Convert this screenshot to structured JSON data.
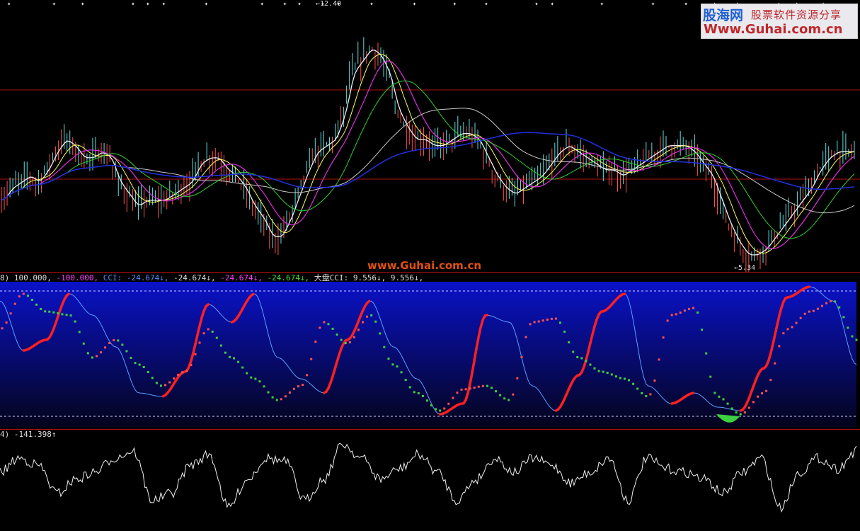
{
  "logo": {
    "name": "股海网",
    "tagline": "股票软件资源分享",
    "url": "Www.Guhai.com.cn"
  },
  "watermark": "www.Guhai.com.cn",
  "main_chart": {
    "high_label": "12.40",
    "low_label": "5.34"
  },
  "cci_panel": {
    "readout": {
      "prefix": "8)",
      "upper": "100.000,",
      "lower": "-100.000,",
      "cci": "CCI: -24.674↓,",
      "v2": "-24.674↓,",
      "v3": "-24.674↓,",
      "v4": "-24.674↓,",
      "dapan": "大盘CCI: 9.556↓,",
      "v6": "9.556↓,"
    }
  },
  "osc_panel": {
    "readout": {
      "prefix": "4)",
      "value": "-141.398↑"
    }
  },
  "colors": {
    "background": "#000000",
    "separator": "#b01010",
    "cci_band_top": "#0a12c8",
    "cci_band_bottom": "#04041a",
    "cci_red": "#ff2020",
    "cci_green": "#3cd040",
    "cci_blue_line": "#5aa0ff",
    "ma_white": "#f0f0f0",
    "ma_yellow": "#ffff60",
    "ma_magenta": "#e030e0",
    "ma_green": "#30d030",
    "ma_blue": "#2030e0",
    "candle_up": "#ff5050",
    "candle_down": "#60e0e0"
  },
  "chart_data": [
    {
      "type": "line",
      "panel": "price",
      "series": [
        {
          "values": [
            24,
            25,
            25.5,
            26,
            25.5,
            26.5,
            28,
            29,
            28.5,
            27.5,
            27.5,
            28,
            27.5,
            25.5,
            24.5,
            23.5,
            24,
            24,
            24,
            24.5,
            25,
            25.5,
            27,
            27.5,
            27.5,
            26.5,
            26,
            25,
            23.5,
            22.5,
            21,
            21,
            22.5,
            24.5,
            26.5,
            28,
            28.5,
            29,
            31,
            34.5,
            35.5,
            36.5,
            36,
            34.5,
            31.5,
            30,
            29,
            29,
            28.5,
            28.5,
            29,
            29.5,
            29.5,
            29,
            27.5,
            26,
            25,
            24.5,
            25,
            25.5,
            26,
            27,
            28,
            28.5,
            28,
            27.5,
            27,
            26.5,
            26.5,
            26,
            26.5,
            27,
            27.5,
            28,
            28.5,
            28.5,
            28.5,
            28,
            27,
            26,
            24,
            22,
            20.5,
            19.5,
            19.5,
            20,
            21,
            22,
            23,
            24,
            25,
            26.5,
            27.5,
            28,
            28,
            28
          ]
        }
      ],
      "high_marker": 12.4,
      "low_marker": 5.34
    },
    {
      "type": "line",
      "panel": "CCI",
      "reference_lines": [
        100,
        -100
      ],
      "series": [
        {
          "name": "CCI",
          "values": [
            -24.674
          ]
        },
        {
          "name": "大盘CCI",
          "values": [
            9.556
          ]
        }
      ]
    },
    {
      "type": "line",
      "panel": "oscillator",
      "series": [
        {
          "values": [
            -141.398
          ]
        }
      ]
    }
  ]
}
